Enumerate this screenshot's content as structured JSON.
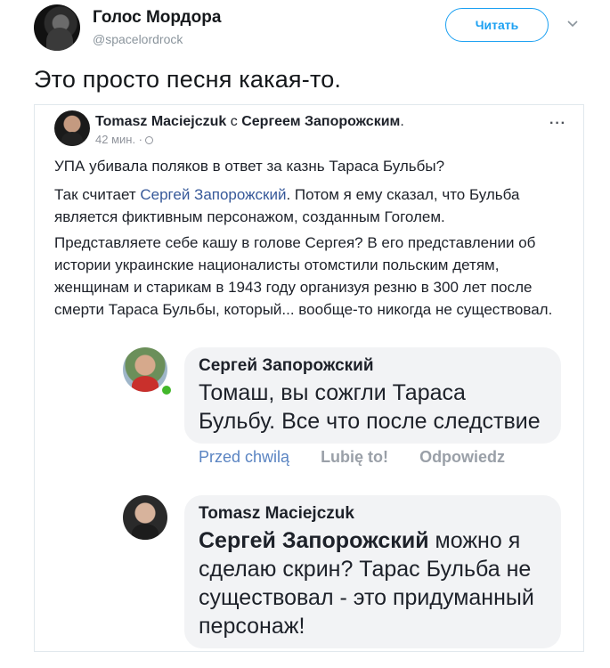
{
  "tweet": {
    "author_name": "Голос Мордора",
    "author_handle": "@spacelordrock",
    "follow_label": "Читать",
    "text": "Это просто песня какая-то."
  },
  "fb_post": {
    "author": "Tomasz Maciejczuk",
    "with_word": "с",
    "tagged": "Сергеем Запорожским",
    "time": "42 мин. ·",
    "more": "···",
    "p1": "УПА убивала поляков в ответ за казнь Тараса Бульбы?",
    "p2_before": "Так считает ",
    "p2_link": "Сергей Запорожский",
    "p2_after": ". Потом я ему сказал, что Бульба является фиктивным персонажом, созданным Гоголем.",
    "p3": "Представляете себе кашу в голове Сергея? В его представлении об истории украинские националисты отомстили польским детям, женщинам и старикам в 1943 году организуя резню в 300 лет после смерти Тараса Бульбы, который... вообще-то никогда не существовал."
  },
  "comment1": {
    "name": "Сергей Запорожский",
    "text": "Томаш, вы сожгли Тараса Бульбу. Все что после следствие",
    "time": "Przed chwilą",
    "like": "Lubię to!",
    "reply": "Odpowiedz"
  },
  "comment2": {
    "name": "Tomasz Maciejczuk",
    "mention": "Сергей Запорожский",
    "text": " можно я сделаю скрин? Тарас Бульба не существовал - это придуманный персонаж!"
  },
  "colors": {
    "twitter_blue": "#1da1f2",
    "fb_link": "#365899",
    "bubble_bg": "#f2f3f5",
    "online_green": "#42b72a"
  }
}
